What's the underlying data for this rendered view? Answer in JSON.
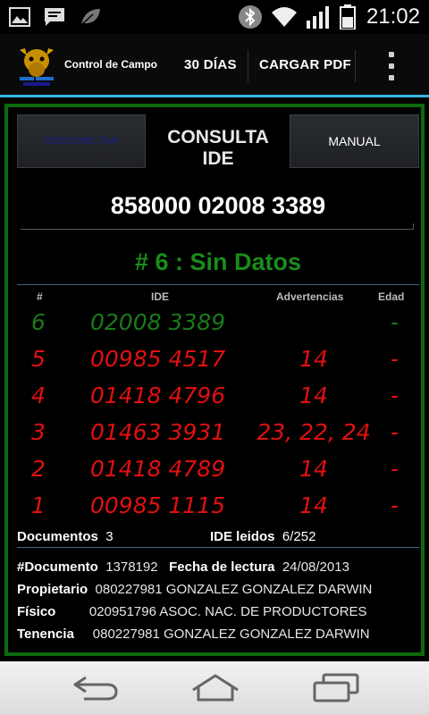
{
  "status_bar": {
    "time": "21:02",
    "icons": [
      "image-icon",
      "message-icon",
      "leaf-icon",
      "bluetooth-icon",
      "wifi-icon",
      "signal-icon",
      "battery-icon"
    ]
  },
  "action_bar": {
    "title": "Control de Campo",
    "btn_30dias": "30 DÍAS",
    "btn_cargar": "CARGAR PDF"
  },
  "panel": {
    "deselect_label": "DESCONECTAR",
    "consulta_line1": "CONSULTA",
    "consulta_line2": "IDE",
    "manual_label": "MANUAL",
    "ide_number": "858000 02008 3389",
    "status_title": "# 6 : Sin Datos"
  },
  "table": {
    "headers": [
      "#",
      "IDE",
      "Advertencias",
      "Edad"
    ],
    "rows": [
      {
        "num": "6",
        "ide": "02008 3389",
        "adv": "",
        "age": "-",
        "color": "#1a7a1a"
      },
      {
        "num": "5",
        "ide": "00985 4517",
        "adv": "14",
        "age": "-",
        "color": "#e01010"
      },
      {
        "num": "4",
        "ide": "01418 4796",
        "adv": "14",
        "age": "-",
        "color": "#e01010"
      },
      {
        "num": "3",
        "ide": "01463 3931",
        "adv": "23, 22, 24",
        "age": "-",
        "color": "#e01010"
      },
      {
        "num": "2",
        "ide": "01418 4789",
        "adv": "14",
        "age": "-",
        "color": "#e01010"
      },
      {
        "num": "1",
        "ide": "00985 1115",
        "adv": "14",
        "age": "-",
        "color": "#e01010"
      }
    ]
  },
  "summary": {
    "docs_label": "Documentos",
    "docs_value": "3",
    "ide_label": "IDE leidos",
    "ide_value": "6/252"
  },
  "info": {
    "doc_label": "#Documento",
    "doc_value": "1378192",
    "fecha_label": "Fecha de lectura",
    "fecha_value": "24/08/2013",
    "prop_label": "Propietario",
    "prop_value": "080227981  GONZALEZ GONZALEZ DARWIN",
    "fisico_label": "Físico",
    "fisico_value": "020951796  ASOC. NAC. DE PRODUCTORES",
    "tenencia_label": "Tenencia",
    "tenencia_value": "080227981 GONZALEZ GONZALEZ DARWIN"
  },
  "colors": {
    "accent": "#33b5e5",
    "panel_border": "#0c6a0c",
    "ok_green": "#1a8c1a",
    "warn_red": "#e01010"
  }
}
